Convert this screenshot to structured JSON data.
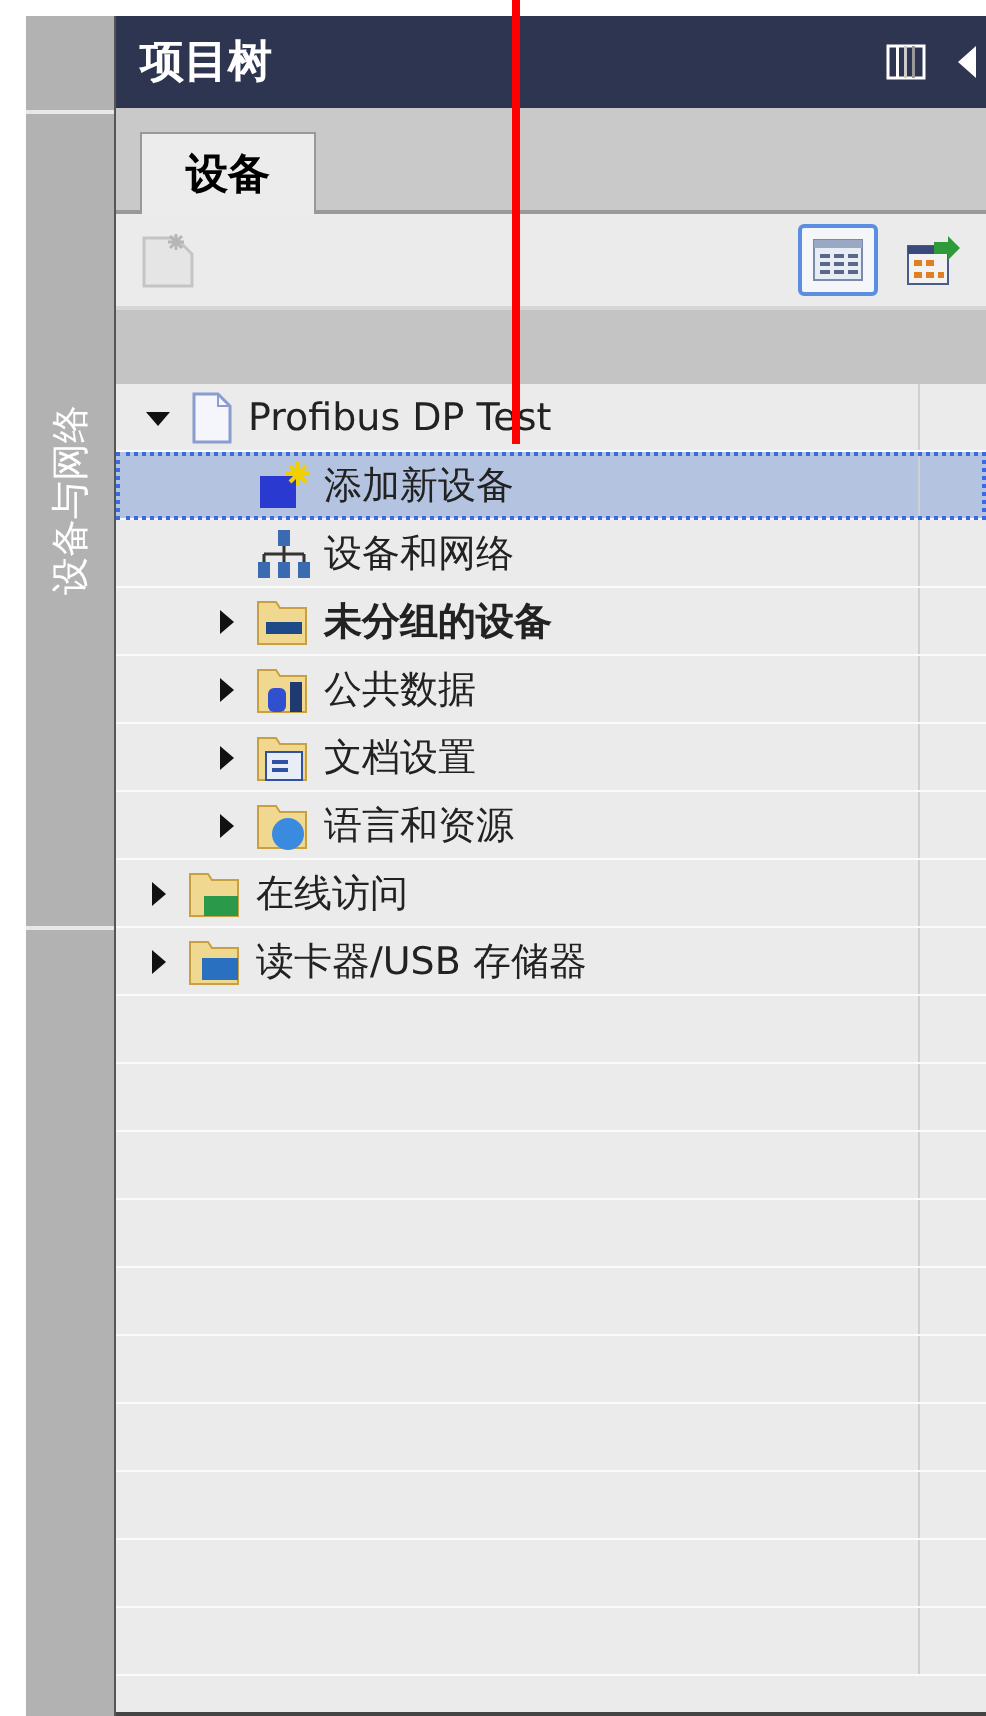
{
  "sidebar": {
    "label": "设备与网络"
  },
  "panel": {
    "title": "项目树"
  },
  "tabs": [
    {
      "label": "设备",
      "selected": true
    }
  ],
  "toolbar": {
    "add_group": {
      "disabled": true
    },
    "views": [
      {
        "kind": "detail",
        "selected": true
      },
      {
        "kind": "overview",
        "selected": false
      }
    ]
  },
  "tree": [
    {
      "label": "Profibus DP Test",
      "kind": "project",
      "bold": false,
      "selected": false,
      "expanded": true,
      "children": [
        {
          "label": "添加新设备",
          "kind": "add-device",
          "bold": false,
          "selected": true
        },
        {
          "label": "设备和网络",
          "kind": "network",
          "bold": false,
          "selected": false
        },
        {
          "label": "未分组的设备",
          "kind": "device-folder",
          "bold": true,
          "selected": false,
          "expanded": false
        },
        {
          "label": "公共数据",
          "kind": "data-folder",
          "bold": false,
          "selected": false,
          "expanded": false
        },
        {
          "label": "文档设置",
          "kind": "doc-folder",
          "bold": false,
          "selected": false,
          "expanded": false
        },
        {
          "label": "语言和资源",
          "kind": "language-folder",
          "bold": false,
          "selected": false,
          "expanded": false
        }
      ]
    },
    {
      "label": "在线访问",
      "kind": "online-folder",
      "bold": false,
      "selected": false,
      "expanded": false
    },
    {
      "label": "读卡器/USB 存储器",
      "kind": "card-folder",
      "bold": false,
      "selected": false,
      "expanded": false
    }
  ]
}
